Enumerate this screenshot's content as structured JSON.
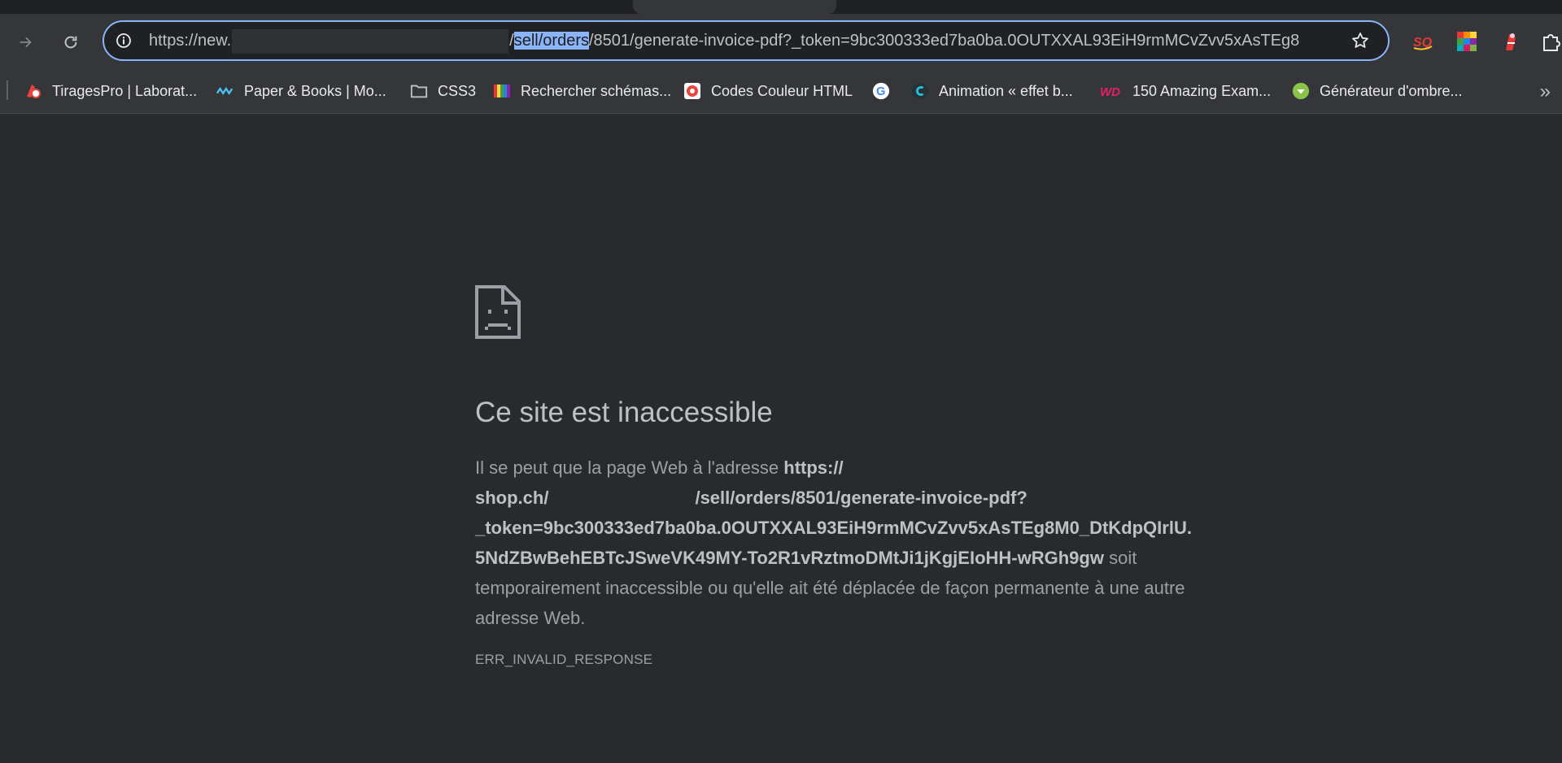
{
  "browser": {
    "url": {
      "prefix": "https://new.",
      "selected": "sell/orders",
      "rest": "/8501/generate-invoice-pdf?_token=9bc300333ed7ba0ba.0OUTXXAL93EiH9rmMCvZvv5xAsTEg8",
      "slash": "/"
    }
  },
  "bookmarks": [
    {
      "label": "TiragesPro | Laborat...",
      "icon": "camera-logo-icon",
      "color": "#e8453c"
    },
    {
      "label": "Paper & Books | Mo...",
      "icon": "wave-logo-icon",
      "color": "#4fc3f7"
    },
    {
      "label": "CSS3",
      "icon": "folder-icon",
      "color": "#bdc1c6"
    },
    {
      "label": "Rechercher schémas...",
      "icon": "color-palette-icon",
      "color": "#f4b400"
    },
    {
      "label": "Codes Couleur HTML",
      "icon": "color-circle-icon",
      "color": "#e8453c"
    },
    {
      "label": "",
      "icon": "google-icon",
      "color": "#4285f4"
    },
    {
      "label": "Animation « effet b...",
      "icon": "c-logo-icon",
      "color": "#26c6da"
    },
    {
      "label": "150 Amazing Exam...",
      "icon": "wd-logo-icon",
      "color": "#e91e63"
    },
    {
      "label": "Générateur d'ombre...",
      "icon": "green-arrow-icon",
      "color": "#8bc34a"
    }
  ],
  "error": {
    "title": "Ce site est inaccessible",
    "intro": "Il se peut que la page Web à l'adresse ",
    "url_line1": "https://",
    "url_line2a": "shop.ch/",
    "url_line2b": "/sell/orders/8501/generate-invoice-pdf?",
    "url_line3": "_token=9bc300333ed7ba0ba.0OUTXXAL93EiH9rmMCvZvv5xAsTEg8M0_DtKdpQIrlU.",
    "url_line4": "5NdZBwBehEBTcJSweVK49MY-To2R1vRztmoDMtJi1jKgjEIoHH-wRGh9gw",
    "outro": " soit temporairement inaccessible ou qu'elle ait été déplacée de façon permanente à une autre adresse Web.",
    "code": "ERR_INVALID_RESPONSE"
  }
}
